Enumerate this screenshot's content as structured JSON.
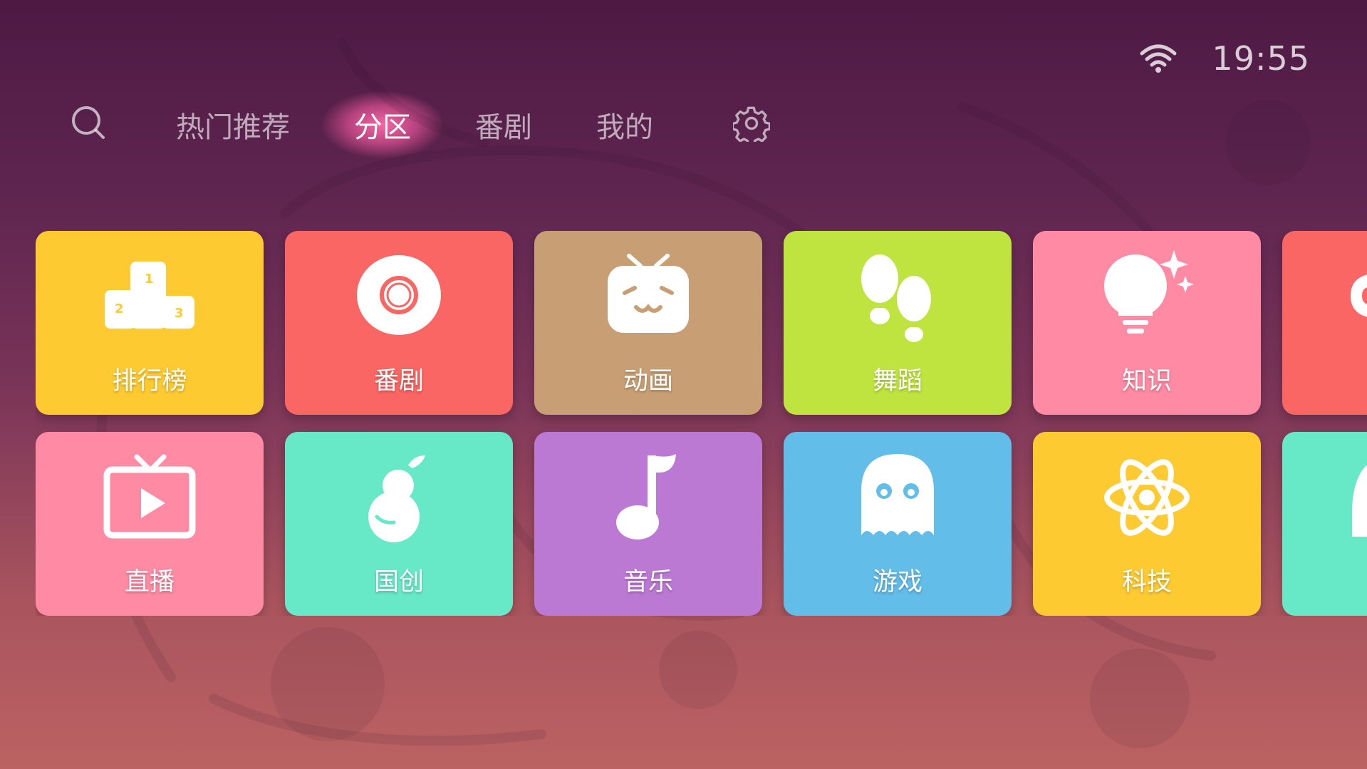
{
  "status": {
    "wifi_icon": "wifi-icon",
    "time": "19:55"
  },
  "nav": {
    "search_icon": "search-icon",
    "tabs": [
      {
        "label": "热门推荐",
        "active": false
      },
      {
        "label": "分区",
        "active": true
      },
      {
        "label": "番剧",
        "active": false
      },
      {
        "label": "我的",
        "active": false
      }
    ],
    "settings_icon": "gear-icon"
  },
  "categories": {
    "row1": [
      {
        "label": "排行榜",
        "icon": "podium-icon",
        "color": "#fdca31"
      },
      {
        "label": "番剧",
        "icon": "record-icon",
        "color": "#f96663"
      },
      {
        "label": "动画",
        "icon": "tv-mascot-icon",
        "color": "#c89f74"
      },
      {
        "label": "舞蹈",
        "icon": "footprints-icon",
        "color": "#bfe43f"
      },
      {
        "label": "知识",
        "icon": "lightbulb-icon",
        "color": "#fe8aa3"
      },
      {
        "label": "",
        "icon": "partial-icon",
        "color": "#f96663"
      }
    ],
    "row2": [
      {
        "label": "直播",
        "icon": "live-tv-icon",
        "color": "#fe8aa3"
      },
      {
        "label": "国创",
        "icon": "gourd-icon",
        "color": "#67e9c8"
      },
      {
        "label": "音乐",
        "icon": "music-note-icon",
        "color": "#bb79d3"
      },
      {
        "label": "游戏",
        "icon": "ghost-icon",
        "color": "#62bde9"
      },
      {
        "label": "科技",
        "icon": "atom-icon",
        "color": "#fdca31"
      },
      {
        "label": "",
        "icon": "partial-icon",
        "color": "#67e9c8"
      }
    ]
  }
}
